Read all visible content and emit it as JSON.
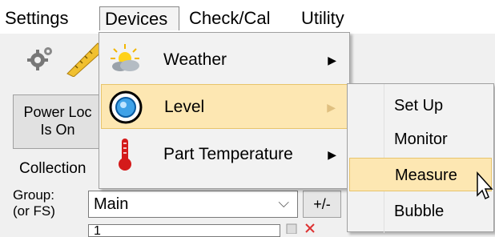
{
  "menubar": {
    "items": [
      "Settings",
      "Devices",
      "Check/Cal",
      "Utility"
    ]
  },
  "toolbar": {
    "icons": [
      "gear-icon",
      "ruler-icon"
    ]
  },
  "left_panel": {
    "power_lock": [
      "Power Loc",
      "Is On"
    ],
    "collection_label": "Collection",
    "group_label": [
      "Group:",
      "(or FS)"
    ],
    "group_value": "Main",
    "plusminus_label": "+/-",
    "under_value": "1"
  },
  "devices_menu": {
    "items": [
      {
        "label": "Weather",
        "icon": "weather-icon",
        "has_submenu": true
      },
      {
        "label": "Level",
        "icon": "level-icon",
        "has_submenu": true,
        "highlighted": true
      },
      {
        "label": "Part Temperature",
        "icon": "thermometer-icon",
        "has_submenu": true
      }
    ]
  },
  "level_submenu": {
    "items": [
      {
        "label": "Set Up"
      },
      {
        "label": "Monitor"
      },
      {
        "label": "Measure",
        "highlighted": true
      },
      {
        "label": "Bubble"
      }
    ]
  },
  "colors": {
    "highlight": "#fde7b2",
    "highlight_border": "#e8c46c",
    "menu_bg": "#f2f2f2"
  }
}
